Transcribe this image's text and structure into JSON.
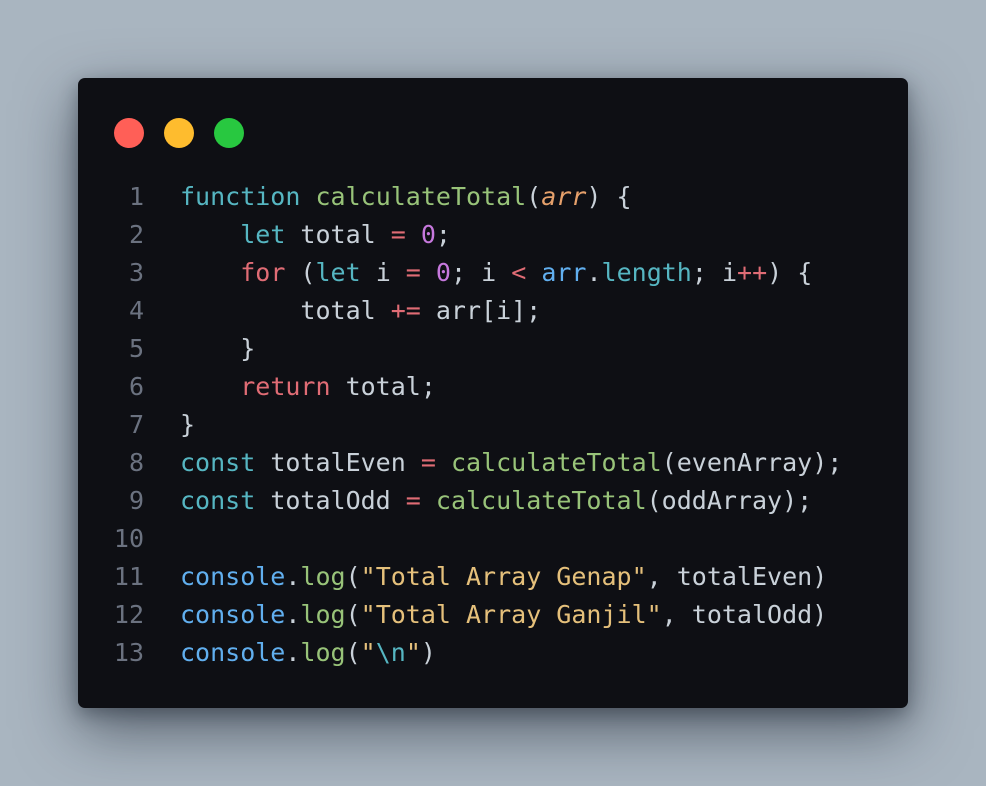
{
  "window": {
    "controls": [
      "close",
      "minimize",
      "maximize"
    ],
    "colors": {
      "close": "#ff5f57",
      "minimize": "#febc2e",
      "maximize": "#28c840",
      "background": "#0e0f14"
    }
  },
  "code": {
    "language": "javascript",
    "lines": [
      {
        "number": "1",
        "tokens": [
          [
            "kw",
            "function"
          ],
          [
            "pun",
            " "
          ],
          [
            "fn",
            "calculateTotal"
          ],
          [
            "pun",
            "("
          ],
          [
            "par",
            "arr"
          ],
          [
            "pun",
            ") {"
          ]
        ]
      },
      {
        "number": "2",
        "tokens": [
          [
            "pun",
            "    "
          ],
          [
            "kw",
            "let"
          ],
          [
            "pun",
            " total "
          ],
          [
            "op",
            "="
          ],
          [
            "pun",
            " "
          ],
          [
            "num",
            "0"
          ],
          [
            "pun",
            ";"
          ]
        ]
      },
      {
        "number": "3",
        "tokens": [
          [
            "pun",
            "    "
          ],
          [
            "ctl",
            "for"
          ],
          [
            "pun",
            " ("
          ],
          [
            "kw",
            "let"
          ],
          [
            "pun",
            " i "
          ],
          [
            "op",
            "="
          ],
          [
            "pun",
            " "
          ],
          [
            "num",
            "0"
          ],
          [
            "pun",
            "; i "
          ],
          [
            "op",
            "<"
          ],
          [
            "pun",
            " "
          ],
          [
            "prop",
            "arr"
          ],
          [
            "pun",
            "."
          ],
          [
            "kw",
            "length"
          ],
          [
            "pun",
            "; i"
          ],
          [
            "op",
            "++"
          ],
          [
            "pun",
            ") {"
          ]
        ]
      },
      {
        "number": "4",
        "tokens": [
          [
            "pun",
            "        total "
          ],
          [
            "op",
            "+="
          ],
          [
            "pun",
            " arr[i];"
          ]
        ]
      },
      {
        "number": "5",
        "tokens": [
          [
            "pun",
            "    }"
          ]
        ]
      },
      {
        "number": "6",
        "tokens": [
          [
            "pun",
            "    "
          ],
          [
            "ctl",
            "return"
          ],
          [
            "pun",
            " total;"
          ]
        ]
      },
      {
        "number": "7",
        "tokens": [
          [
            "pun",
            "}"
          ]
        ]
      },
      {
        "number": "8",
        "tokens": [
          [
            "kw",
            "const"
          ],
          [
            "pun",
            " totalEven "
          ],
          [
            "op",
            "="
          ],
          [
            "pun",
            " "
          ],
          [
            "fn",
            "calculateTotal"
          ],
          [
            "pun",
            "(evenArray);"
          ]
        ]
      },
      {
        "number": "9",
        "tokens": [
          [
            "kw",
            "const"
          ],
          [
            "pun",
            " totalOdd "
          ],
          [
            "op",
            "="
          ],
          [
            "pun",
            " "
          ],
          [
            "fn",
            "calculateTotal"
          ],
          [
            "pun",
            "(oddArray);"
          ]
        ]
      },
      {
        "number": "10",
        "tokens": []
      },
      {
        "number": "11",
        "tokens": [
          [
            "prop",
            "console"
          ],
          [
            "pun",
            "."
          ],
          [
            "fn",
            "log"
          ],
          [
            "pun",
            "("
          ],
          [
            "str",
            "\"Total Array Genap\""
          ],
          [
            "pun",
            ", totalEven)"
          ]
        ]
      },
      {
        "number": "12",
        "tokens": [
          [
            "prop",
            "console"
          ],
          [
            "pun",
            "."
          ],
          [
            "fn",
            "log"
          ],
          [
            "pun",
            "("
          ],
          [
            "str",
            "\"Total Array Ganjil\""
          ],
          [
            "pun",
            ", totalOdd)"
          ]
        ]
      },
      {
        "number": "13",
        "tokens": [
          [
            "prop",
            "console"
          ],
          [
            "pun",
            "."
          ],
          [
            "fn",
            "log"
          ],
          [
            "pun",
            "("
          ],
          [
            "str",
            "\""
          ],
          [
            "kw",
            "\\n"
          ],
          [
            "str",
            "\""
          ],
          [
            "pun",
            ")"
          ]
        ]
      }
    ]
  }
}
